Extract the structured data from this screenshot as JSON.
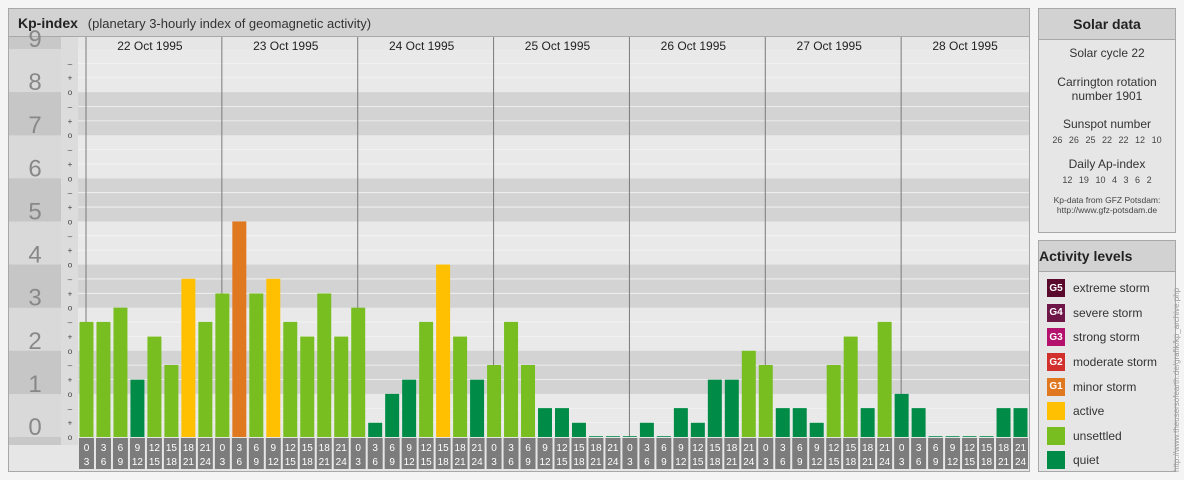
{
  "header": {
    "title": "Kp-index",
    "subtitle": "(planetary 3-hourly index of geomagnetic activity)"
  },
  "chart_data": {
    "type": "bar",
    "title": "Kp-index",
    "subtitle": "(planetary 3-hourly index of geomagnetic activity)",
    "ylim": [
      0,
      9
    ],
    "y_ticks": [
      "0",
      "1",
      "2",
      "3",
      "4",
      "5",
      "6",
      "7",
      "8",
      "9"
    ],
    "y_minor_ticks": [
      "o",
      "+",
      "–"
    ],
    "days": [
      "22 Oct 1995",
      "23 Oct 1995",
      "24 Oct 1995",
      "25 Oct 1995",
      "26 Oct 1995",
      "27 Oct 1995",
      "28 Oct 1995"
    ],
    "interval_start_labels": [
      "0",
      "3",
      "6",
      "9",
      "12",
      "15",
      "18",
      "21"
    ],
    "interval_end_labels": [
      "3",
      "6",
      "9",
      "12",
      "15",
      "18",
      "21",
      "24"
    ],
    "values": [
      [
        2.67,
        2.67,
        3.0,
        1.33,
        2.33,
        1.67,
        3.67,
        2.67
      ],
      [
        3.33,
        5.0,
        3.33,
        3.67,
        2.67,
        2.33,
        3.33,
        2.33
      ],
      [
        3.0,
        0.33,
        1.0,
        1.33,
        2.67,
        4.0,
        2.33,
        1.33
      ],
      [
        1.67,
        2.67,
        1.67,
        0.67,
        0.67,
        0.33,
        0.0,
        0.0
      ],
      [
        0.0,
        0.33,
        0.0,
        0.67,
        0.33,
        1.33,
        1.33,
        2.0
      ],
      [
        1.67,
        0.67,
        0.67,
        0.33,
        1.67,
        2.33,
        0.67,
        2.67
      ],
      [
        1.0,
        0.67,
        0.0,
        0.0,
        0.0,
        0.0,
        0.67,
        0.67
      ]
    ],
    "grid": true,
    "colors": {
      "quiet": "#008c46",
      "unsettled": "#78be20",
      "active": "#fec000",
      "minor_storm": "#e07820"
    }
  },
  "solar": {
    "title": "Solar data",
    "cycle": "Solar cycle 22",
    "carrington": "Carrington rotation number 1901",
    "sunspot_title": "Sunspot number",
    "sunspot_values": [
      "26",
      "26",
      "25",
      "22",
      "22",
      "12",
      "10"
    ],
    "ap_title": "Daily Ap-index",
    "ap_values": [
      "12",
      "19",
      "10",
      "4",
      "3",
      "6",
      "2"
    ],
    "source_line1": "Kp-data from GFZ Potsdam:",
    "source_line2": "http://www.gfz-potsdam.de"
  },
  "levels": {
    "title": "Activity levels",
    "items": [
      {
        "code": "G5",
        "label": "extreme storm",
        "color": "#5a0a2c"
      },
      {
        "code": "G4",
        "label": "severe storm",
        "color": "#6e1648"
      },
      {
        "code": "G3",
        "label": "strong storm",
        "color": "#b4106e"
      },
      {
        "code": "G2",
        "label": "moderate storm",
        "color": "#d2302c"
      },
      {
        "code": "G1",
        "label": "minor storm",
        "color": "#e07820"
      },
      {
        "code": "",
        "label": "active",
        "color": "#fec000"
      },
      {
        "code": "",
        "label": "unsettled",
        "color": "#78be20"
      },
      {
        "code": "",
        "label": "quiet",
        "color": "#008c46"
      }
    ]
  },
  "watermark": "http://www.theusersofearth.de/grafik/kp_archive.php"
}
